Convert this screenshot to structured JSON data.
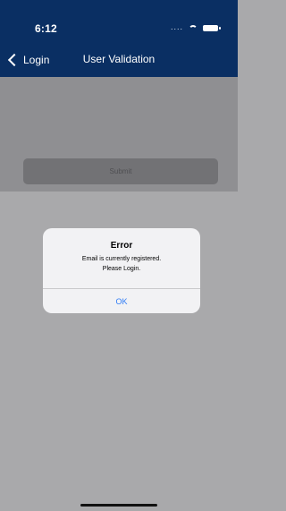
{
  "status_bar": {
    "time": "6:12",
    "signal": "....",
    "wifi_icon": "wifi-icon",
    "battery_icon": "battery-icon"
  },
  "nav": {
    "back_label": "Login",
    "title": "User Validation"
  },
  "form": {
    "submit_label": "Submit"
  },
  "alert": {
    "title": "Error",
    "message_line1": "Email is currently registered.",
    "message_line2": "Please Login.",
    "ok_label": "OK"
  },
  "colors": {
    "nav_blue": "#0a2f63",
    "alert_button_blue": "#2f7cf6"
  }
}
